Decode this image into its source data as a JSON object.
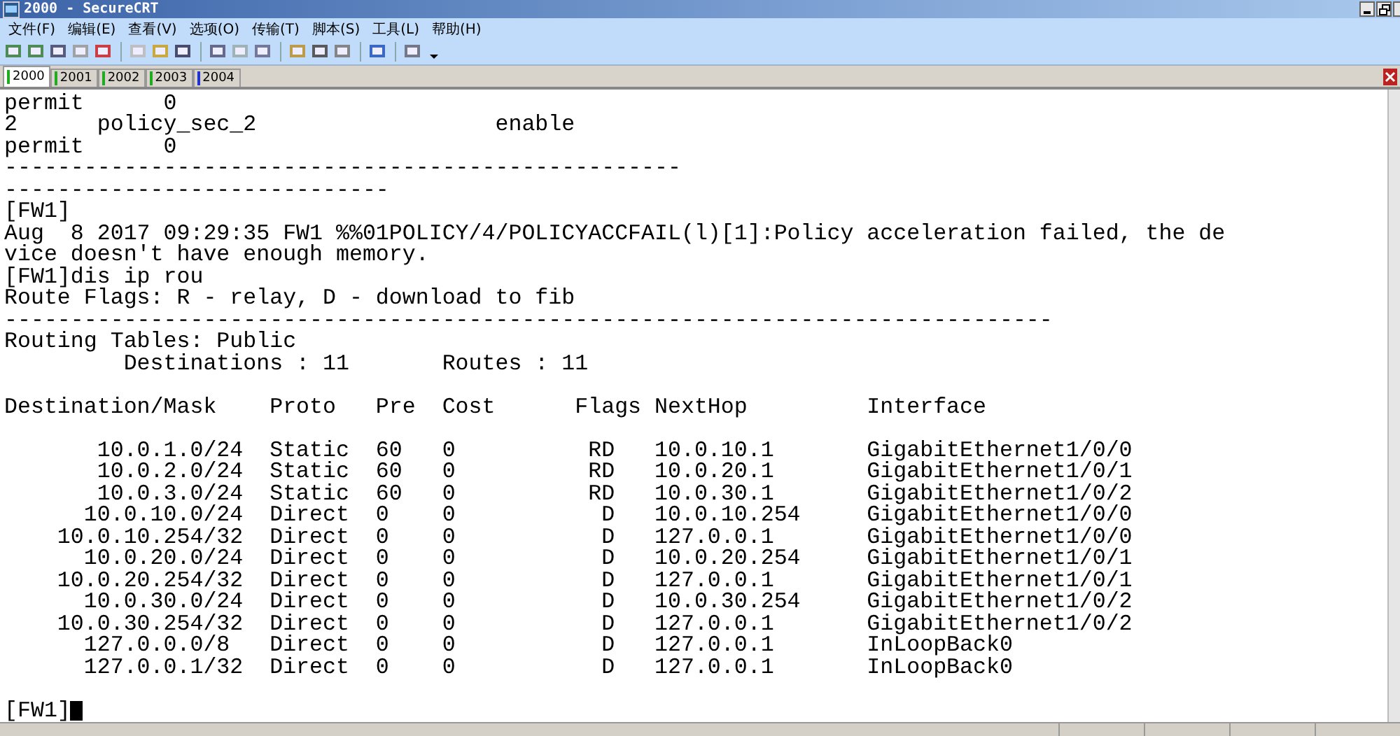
{
  "window": {
    "title": "2000 - SecureCRT"
  },
  "menu": [
    "文件(F)",
    "编辑(E)",
    "查看(V)",
    "选项(O)",
    "传输(T)",
    "脚本(S)",
    "工具(L)",
    "帮助(H)"
  ],
  "tabs": [
    {
      "label": "2000",
      "selected": true,
      "color": "#22aa22"
    },
    {
      "label": "2001",
      "selected": false,
      "color": "#22aa22"
    },
    {
      "label": "2002",
      "selected": false,
      "color": "#22aa22"
    },
    {
      "label": "2003",
      "selected": false,
      "color": "#22aa22"
    },
    {
      "label": "2004",
      "selected": false,
      "color": "#2233cc"
    }
  ],
  "terminal": {
    "lines": [
      {
        "kind": "text",
        "text": "permit      0"
      },
      {
        "kind": "text",
        "text": "2      policy_sec_2                  enable"
      },
      {
        "kind": "text",
        "text": "permit      0"
      },
      {
        "kind": "text",
        "text": "---------------------------------------------------"
      },
      {
        "kind": "text",
        "text": "-----------------------------"
      },
      {
        "kind": "text",
        "text": "[FW1]"
      },
      {
        "kind": "text",
        "text": "Aug  8 2017 09:29:35 FW1 %%01POLICY/4/POLICYACCFAIL(l)[1]:Policy acceleration failed, the de"
      },
      {
        "kind": "text",
        "text": "vice doesn't have enough memory."
      },
      {
        "kind": "text",
        "text": "[FW1]dis ip rou"
      },
      {
        "kind": "text",
        "text": "Route Flags: R - relay, D - download to fib"
      },
      {
        "kind": "text",
        "text": "-------------------------------------------------------------------------------"
      },
      {
        "kind": "text",
        "text": "Routing Tables: Public"
      },
      {
        "kind": "text",
        "text": "         Destinations : 11       Routes : 11"
      },
      {
        "kind": "blank"
      },
      {
        "kind": "text",
        "text": "Destination/Mask    Proto   Pre  Cost      Flags NextHop         Interface"
      },
      {
        "kind": "blank"
      },
      {
        "kind": "text",
        "text": "       10.0.1.0/24  Static  60   0          RD   10.0.10.1       GigabitEthernet1/0/0"
      },
      {
        "kind": "text",
        "text": "       10.0.2.0/24  Static  60   0          RD   10.0.20.1       GigabitEthernet1/0/1"
      },
      {
        "kind": "text",
        "text": "       10.0.3.0/24  Static  60   0          RD   10.0.30.1       GigabitEthernet1/0/2"
      },
      {
        "kind": "text",
        "text": "      10.0.10.0/24  Direct  0    0           D   10.0.10.254     GigabitEthernet1/0/0"
      },
      {
        "kind": "text",
        "text": "    10.0.10.254/32  Direct  0    0           D   127.0.0.1       GigabitEthernet1/0/0"
      },
      {
        "kind": "text",
        "text": "      10.0.20.0/24  Direct  0    0           D   10.0.20.254     GigabitEthernet1/0/1"
      },
      {
        "kind": "text",
        "text": "    10.0.20.254/32  Direct  0    0           D   127.0.0.1       GigabitEthernet1/0/1"
      },
      {
        "kind": "text",
        "text": "      10.0.30.0/24  Direct  0    0           D   10.0.30.254     GigabitEthernet1/0/2"
      },
      {
        "kind": "text",
        "text": "    10.0.30.254/32  Direct  0    0           D   127.0.0.1       GigabitEthernet1/0/2"
      },
      {
        "kind": "text",
        "text": "      127.0.0.0/8   Direct  0    0           D   127.0.0.1       InLoopBack0"
      },
      {
        "kind": "text",
        "text": "      127.0.0.1/32  Direct  0    0           D   127.0.0.1       InLoopBack0"
      },
      {
        "kind": "blank"
      },
      {
        "kind": "prompt",
        "text": "[FW1]"
      }
    ]
  }
}
